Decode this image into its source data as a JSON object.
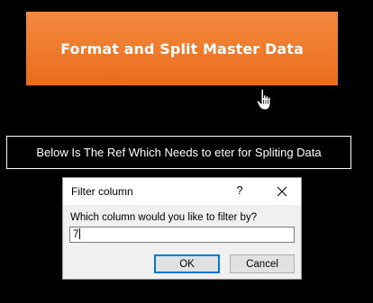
{
  "macro_button": {
    "label": "Format and Split Master Data"
  },
  "ref_box": {
    "text": "Below Is The Ref Which Needs to eter for Spliting Data"
  },
  "dialog": {
    "title": "Filter column",
    "help_label": "?",
    "prompt": "Which column would you like to filter by?",
    "input_value": "7",
    "ok_label": "OK",
    "cancel_label": "Cancel"
  },
  "colors": {
    "background": "#000000",
    "button_orange": "#ef7a2c",
    "ok_focus_border": "#0078d7"
  }
}
